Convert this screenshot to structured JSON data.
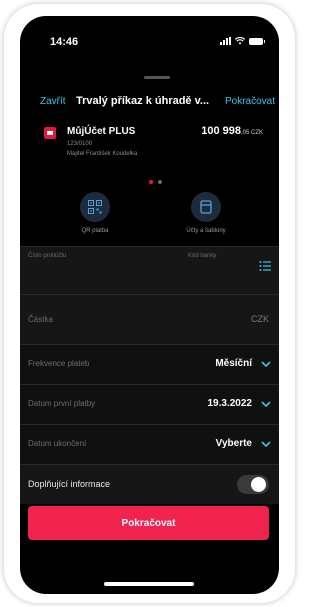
{
  "status_bar": {
    "time": "14:46"
  },
  "header": {
    "close_label": "Zavřít",
    "title": "Trvalý příkaz k úhradě v...",
    "continue_label": "Pokračovat"
  },
  "account": {
    "name": "MůjÚčet PLUS",
    "number": "123/0100",
    "owner": "Majitel František Koudelka",
    "balance_main": "100 998",
    "balance_decimals": ",05 CZK"
  },
  "pager": {
    "page": 1,
    "total": 2
  },
  "quick_actions": [
    {
      "label": "QR platba",
      "icon": "qr-code-icon"
    },
    {
      "label": "Účty a šablony",
      "icon": "templates-icon"
    }
  ],
  "form": {
    "account_number_label": "Číslo protiúčtu",
    "bank_code_label": "Kód banky",
    "amount_label": "Částka",
    "currency": "CZK",
    "frequency_label": "Frekvence plateb",
    "frequency_value": "Měsíční",
    "first_payment_label": "Datum první platby",
    "first_payment_value": "19.3.2022",
    "end_date_label": "Datum ukončení",
    "end_date_value": "Vyberte",
    "additional_info_label": "Doplňující informace",
    "additional_info_enabled": false
  },
  "primary_button_label": "Pokračovat",
  "colors": {
    "accent": "#3ec3e6",
    "brand": "#f0234e",
    "background": "#000000"
  }
}
